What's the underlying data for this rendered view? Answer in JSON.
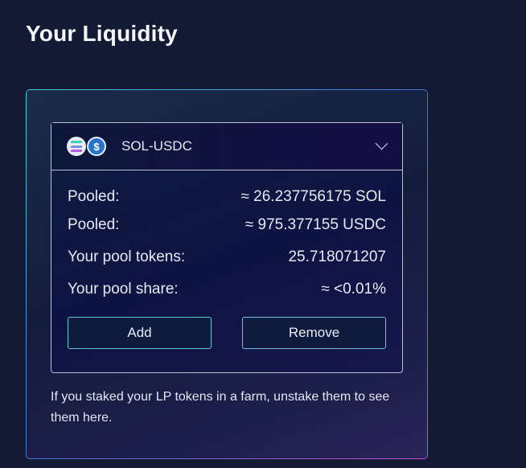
{
  "page": {
    "title": "Your Liquidity"
  },
  "pool": {
    "pair": "SOL-USDC",
    "tokens": [
      {
        "symbol": "SOL",
        "icon": "solana-icon"
      },
      {
        "symbol": "USDC",
        "icon": "usdc-icon",
        "glyph": "$"
      }
    ],
    "rows": [
      {
        "label": "Pooled:",
        "value": "≈ 26.237756175 SOL"
      },
      {
        "label": "Pooled:",
        "value": "≈ 975.377155 USDC"
      },
      {
        "label": "Your pool tokens:",
        "value": "25.718071207"
      },
      {
        "label": "Your pool share:",
        "value": "≈ <0.01%"
      }
    ],
    "actions": {
      "add_label": "Add",
      "remove_label": "Remove"
    }
  },
  "note": "If you staked your LP tokens in a farm, unstake them to see them here.",
  "colors": {
    "background": "#131a33",
    "accent_cyan": "#3fd1d6",
    "accent_purple": "#c34ae0",
    "usdc_blue": "#2775ca"
  }
}
